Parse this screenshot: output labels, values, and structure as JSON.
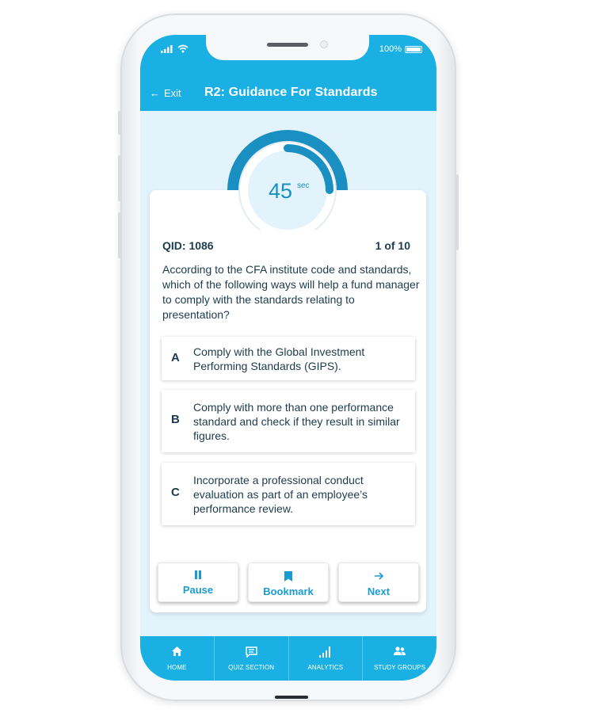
{
  "status_bar": {
    "battery": "100%"
  },
  "header": {
    "exit_label": "Exit",
    "title": "R2: Guidance For Standards"
  },
  "timer": {
    "value": "45",
    "unit": "sec",
    "progress": 0.25
  },
  "question": {
    "qid": "QID: 1086",
    "counter": "1 of 10",
    "text": "According to the CFA institute code and standards, which of the following ways will help a fund manager to comply with the standards relating to presentation?"
  },
  "options": [
    {
      "letter": "A",
      "text": "Comply with the Global Investment Performing Standards (GIPS)."
    },
    {
      "letter": "B",
      "text": "Comply with more than one performance standard and check if they result in similar figures."
    },
    {
      "letter": "C",
      "text": "Incorporate a professional conduct evaluation as part of an employee’s performance review."
    }
  ],
  "actions": {
    "pause": "Pause",
    "bookmark": "Bookmark",
    "next": "Next"
  },
  "nav": {
    "home": "HOME",
    "quiz": "QUIZ SECTION",
    "analytics": "ANALYTICS",
    "groups": "STUDY GROUPS"
  },
  "colors": {
    "primary": "#1ab0e4",
    "background": "#e3f3fb",
    "text": "#1d3b4c",
    "accent": "#1a9bd0"
  }
}
